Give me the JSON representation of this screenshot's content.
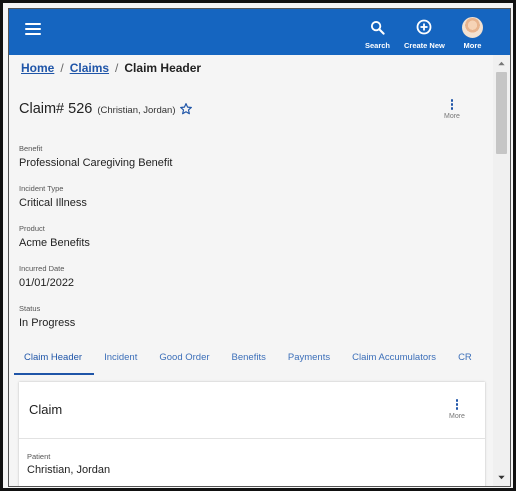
{
  "header": {
    "menu_icon": "hamburger-menu-icon",
    "actions": [
      {
        "label": "Search",
        "icon": "search-icon"
      },
      {
        "label": "Create New",
        "icon": "plus-circle-icon"
      },
      {
        "label": "More",
        "icon": "user-avatar"
      }
    ],
    "color": "#1565c0"
  },
  "breadcrumb": {
    "items": [
      "Home",
      "Claims"
    ],
    "separator": "/",
    "current": "Claim Header"
  },
  "claim": {
    "title": "Claim# 526",
    "patient_short": "(Christian, Jordan)",
    "more_label": "More"
  },
  "fields": [
    {
      "label": "Benefit",
      "value": "Professional Caregiving Benefit"
    },
    {
      "label": "Incident Type",
      "value": "Critical Illness"
    },
    {
      "label": "Product",
      "value": "Acme Benefits"
    },
    {
      "label": "Incurred Date",
      "value": "01/01/2022"
    },
    {
      "label": "Status",
      "value": "In Progress"
    }
  ],
  "tabs": [
    "Claim Header",
    "Incident",
    "Good Order",
    "Benefits",
    "Payments",
    "Claim Accumulators",
    "CR"
  ],
  "active_tab": "Claim Header",
  "card": {
    "title": "Claim",
    "more_label": "More",
    "field": {
      "label": "Patient",
      "value": "Christian, Jordan"
    }
  },
  "colors": {
    "accent": "#1f55a8",
    "tab_text": "#3c6fb9"
  }
}
